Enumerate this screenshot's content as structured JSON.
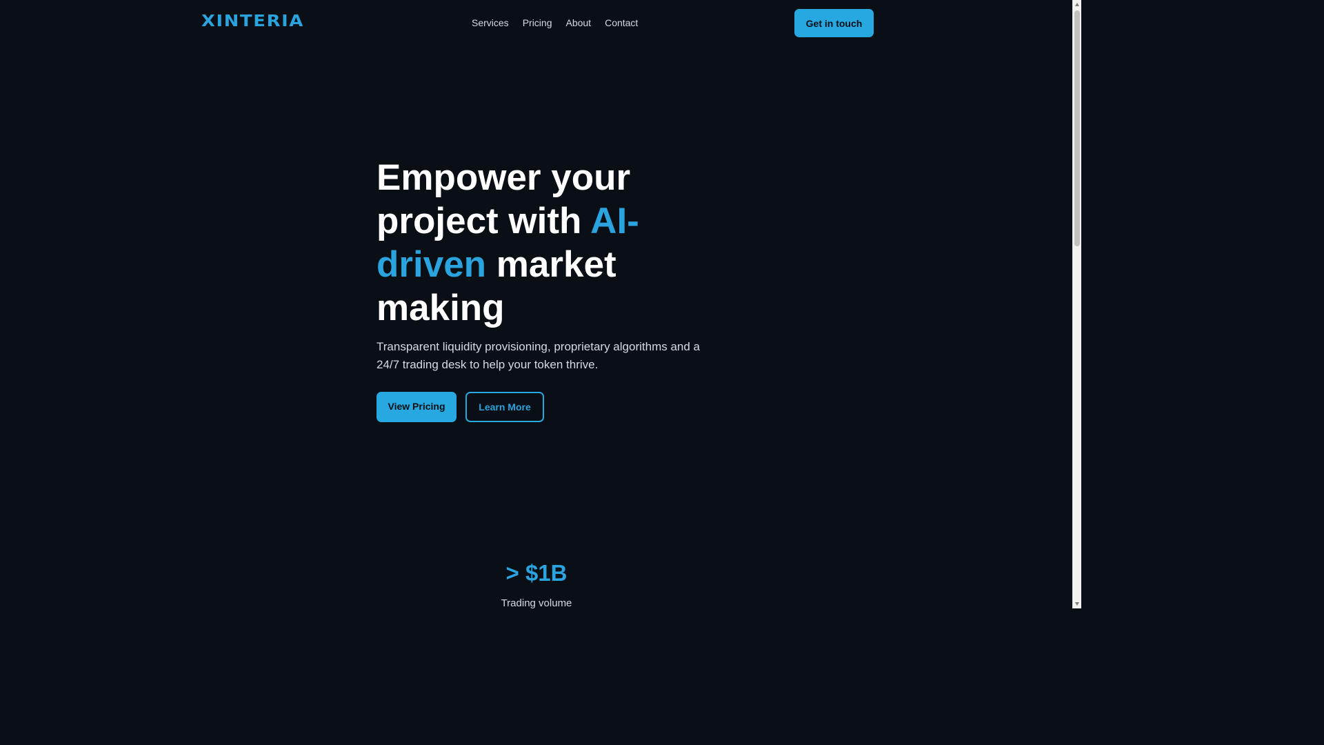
{
  "header": {
    "logo_text": "XINTERIA",
    "nav": [
      "Services",
      "Pricing",
      "About",
      "Contact"
    ],
    "cta_label": "Get in touch"
  },
  "hero": {
    "title_line1": "Empower your project with",
    "title_accent": "AI-driven",
    "title_line2": "market making",
    "subtitle": "Transparent liquidity provisioning, proprietary algorithms and a 24/7 trading desk to help your token thrive.",
    "primary_button": "View Pricing",
    "secondary_button": "Learn More"
  },
  "stats": [
    {
      "value": "> $1B",
      "label": "Trading volume"
    }
  ],
  "colors": {
    "background": "#0a0e15",
    "accent": "#2aa3df",
    "text": "#ffffff",
    "muted": "#d5dbe3"
  }
}
